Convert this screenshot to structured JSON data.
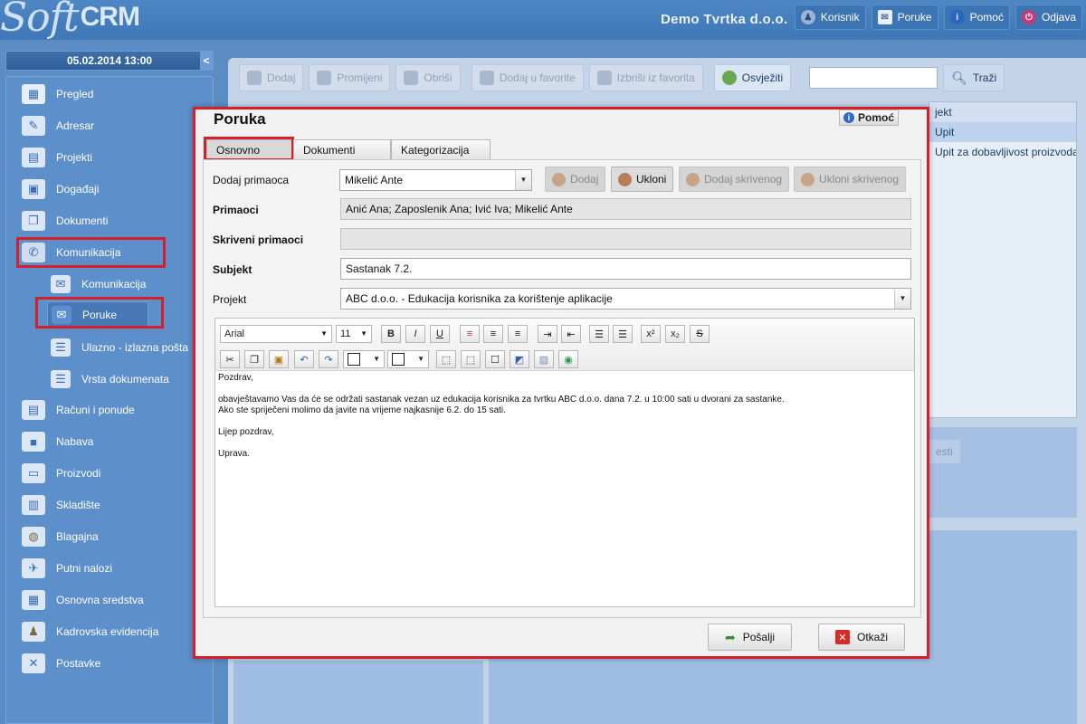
{
  "app": {
    "logo_main": "Soft",
    "logo_suffix": "CRM",
    "company": "Demo Tvrtka d.o.o."
  },
  "topnav": [
    {
      "label": "Korisnik",
      "icon": "user-icon"
    },
    {
      "label": "Poruke",
      "icon": "envelope-icon"
    },
    {
      "label": "Pomoć",
      "icon": "info-icon"
    },
    {
      "label": "Odjava",
      "icon": "power-icon"
    }
  ],
  "datetime": "05.02.2014 13:00",
  "collapse_glyph": "<",
  "sidebar": {
    "items": [
      {
        "label": "Pregled",
        "icon": "overview-icon"
      },
      {
        "label": "Adresar",
        "icon": "address-book-icon"
      },
      {
        "label": "Projekti",
        "icon": "projects-icon"
      },
      {
        "label": "Događaji",
        "icon": "calendar-icon"
      },
      {
        "label": "Dokumenti",
        "icon": "documents-icon"
      },
      {
        "label": "Komunikacija",
        "icon": "communication-icon"
      },
      {
        "label": "Komunikacija",
        "icon": "communication-sub-icon"
      },
      {
        "label": "Poruke",
        "icon": "messages-icon"
      },
      {
        "label": "Ulazno - izlazna pošta",
        "icon": "mail-log-icon"
      },
      {
        "label": "Vrsta dokumenata",
        "icon": "doc-type-icon"
      },
      {
        "label": "Računi i ponude",
        "icon": "invoices-icon"
      },
      {
        "label": "Nabava",
        "icon": "procurement-icon"
      },
      {
        "label": "Proizvodi",
        "icon": "products-icon"
      },
      {
        "label": "Skladište",
        "icon": "warehouse-icon"
      },
      {
        "label": "Blagajna",
        "icon": "cash-register-icon"
      },
      {
        "label": "Putni nalozi",
        "icon": "travel-orders-icon"
      },
      {
        "label": "Osnovna sredstva",
        "icon": "fixed-assets-icon"
      },
      {
        "label": "Kadrovska evidencija",
        "icon": "hr-icon"
      },
      {
        "label": "Postavke",
        "icon": "settings-icon"
      }
    ]
  },
  "toolbar": {
    "add": "Dodaj",
    "edit": "Promijeni",
    "delete": "Obriši",
    "fav_add": "Dodaj u favorite",
    "fav_remove": "Izbriši iz favorita",
    "refresh": "Osvježiti",
    "search_value": "",
    "search_btn": "Traži"
  },
  "bglist": {
    "header": "jekt",
    "rows": [
      "Upit",
      "Upit za dobavljivost proizvoda"
    ]
  },
  "bgghost": "esti",
  "dialog": {
    "title": "Poruka",
    "help": "Pomoć",
    "tabs": [
      "Osnovno",
      "Dokumenti",
      "Kategorizacija"
    ],
    "labels": {
      "add_recipient": "Dodaj primaoca",
      "recipients": "Primaoci",
      "hidden_recipients": "Skriveni primaoci",
      "subject": "Subjekt",
      "project": "Projekt"
    },
    "recipient_select": "Mikelić Ante",
    "buttons": {
      "add": "Dodaj",
      "remove": "Ukloni",
      "add_hidden": "Dodaj skrivenog",
      "remove_hidden": "Ukloni skrivenog"
    },
    "recipients_value": "Anić Ana; Zaposlenik Ana; Ivić Iva; Mikelić Ante",
    "hidden_value": "",
    "subject_value": "Sastanak 7.2.",
    "project_value": "ABC d.o.o. - Edukacija korisnika za korištenje aplikacije",
    "editor": {
      "font": "Arial",
      "size": "11",
      "body": [
        "Pozdrav,",
        "",
        "obavještavamo Vas da će se održati sastanak vezan uz edukacija korisnika za tvrtku ABC d.o.o. dana 7.2. u 10:00 sati u dvorani za sastanke.",
        "Ako ste spriječeni molimo da javite na vrijeme najkasnije 6.2. do 15 sati.",
        "",
        "Lijep pozdrav,",
        "",
        "Uprava."
      ]
    },
    "send": "Pošalji",
    "cancel": "Otkaži"
  },
  "colors": {
    "highlight": "#d4202b",
    "brand_blue": "#4f86c4"
  }
}
